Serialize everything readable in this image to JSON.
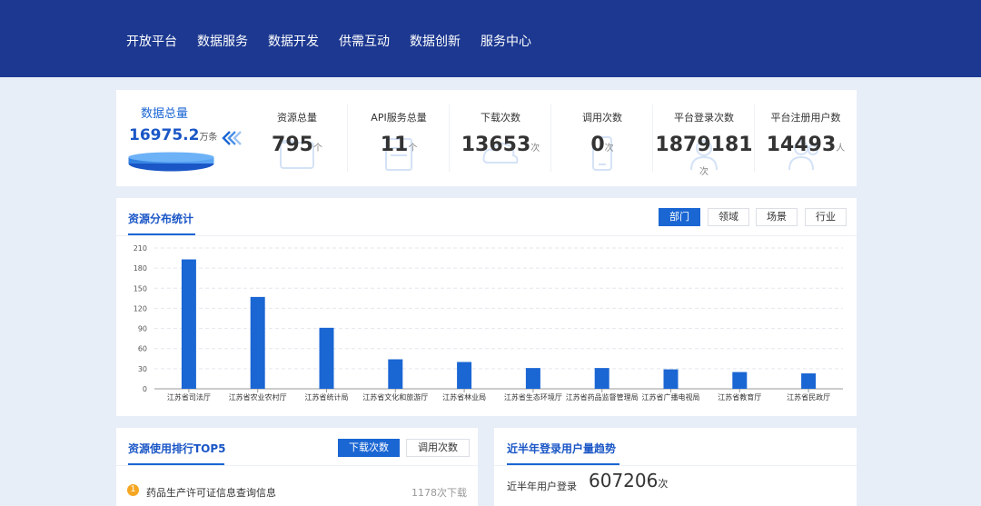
{
  "nav": {
    "items": [
      "开放平台",
      "数据服务",
      "数据开发",
      "供需互动",
      "数据创新",
      "服务中心"
    ]
  },
  "summary": {
    "total_title": "数据总量",
    "total_value": "16975.2",
    "total_unit": "万条",
    "stats": [
      {
        "label": "资源总量",
        "value": "795",
        "unit": "个"
      },
      {
        "label": "API服务总量",
        "value": "11",
        "unit": "个"
      },
      {
        "label": "下载次数",
        "value": "13653",
        "unit": "次"
      },
      {
        "label": "调用次数",
        "value": "0",
        "unit": "次"
      },
      {
        "label": "平台登录次数",
        "value": "1879181",
        "unit": "次"
      },
      {
        "label": "平台注册用户数",
        "value": "14493",
        "unit": "人"
      }
    ]
  },
  "distribution": {
    "title": "资源分布统计",
    "tabs": [
      {
        "label": "部门",
        "active": true
      },
      {
        "label": "领域",
        "active": false
      },
      {
        "label": "场景",
        "active": false
      },
      {
        "label": "行业",
        "active": false
      }
    ]
  },
  "chart_data": {
    "type": "bar",
    "categories": [
      "江苏省司法厅",
      "江苏省农业农村厅",
      "江苏省统计局",
      "江苏省文化和旅游厅",
      "江苏省林业局",
      "江苏省生态环境厅",
      "江苏省药品监督管理局",
      "江苏省广播电视局",
      "江苏省教育厅",
      "江苏省民政厅"
    ],
    "values": [
      193,
      137,
      91,
      44,
      40,
      31,
      31,
      29,
      25,
      23
    ],
    "ylim": [
      0,
      210
    ],
    "yticks": [
      0,
      30,
      60,
      90,
      120,
      150,
      180,
      210
    ],
    "grid": true,
    "bar_color": "#1a66d3"
  },
  "ranking": {
    "title": "资源使用排行TOP5",
    "tabs": [
      {
        "label": "下载次数",
        "active": true
      },
      {
        "label": "调用次数",
        "active": false
      }
    ],
    "items": [
      {
        "rank": "1",
        "name": "药品生产许可证信息查询信息",
        "count": "1178次下载"
      }
    ]
  },
  "trend": {
    "title": "近半年登录用户量趋势",
    "label": "近半年用户登录",
    "value": "607206",
    "unit": "次"
  },
  "colors": {
    "header": "#1c3890",
    "accent": "#1a66d3",
    "background": "#e8eef7",
    "medal": "#f5a623"
  }
}
